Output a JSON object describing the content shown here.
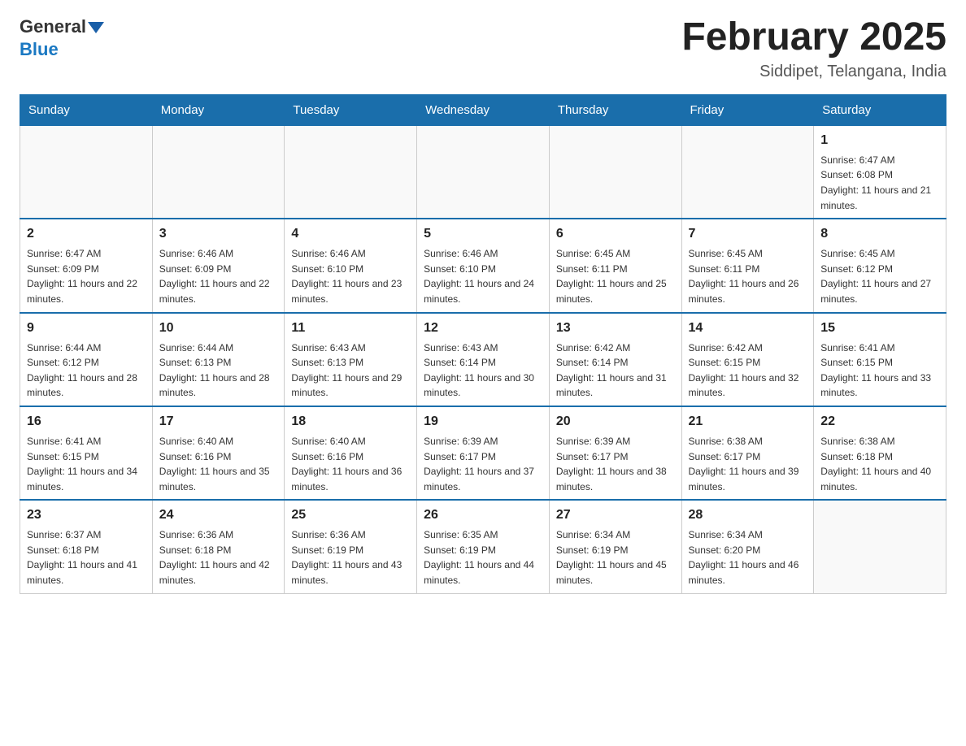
{
  "header": {
    "logo_general": "General",
    "logo_blue": "Blue",
    "title": "February 2025",
    "subtitle": "Siddipet, Telangana, India"
  },
  "weekdays": [
    "Sunday",
    "Monday",
    "Tuesday",
    "Wednesday",
    "Thursday",
    "Friday",
    "Saturday"
  ],
  "weeks": [
    [
      {
        "day": "",
        "info": ""
      },
      {
        "day": "",
        "info": ""
      },
      {
        "day": "",
        "info": ""
      },
      {
        "day": "",
        "info": ""
      },
      {
        "day": "",
        "info": ""
      },
      {
        "day": "",
        "info": ""
      },
      {
        "day": "1",
        "info": "Sunrise: 6:47 AM\nSunset: 6:08 PM\nDaylight: 11 hours and 21 minutes."
      }
    ],
    [
      {
        "day": "2",
        "info": "Sunrise: 6:47 AM\nSunset: 6:09 PM\nDaylight: 11 hours and 22 minutes."
      },
      {
        "day": "3",
        "info": "Sunrise: 6:46 AM\nSunset: 6:09 PM\nDaylight: 11 hours and 22 minutes."
      },
      {
        "day": "4",
        "info": "Sunrise: 6:46 AM\nSunset: 6:10 PM\nDaylight: 11 hours and 23 minutes."
      },
      {
        "day": "5",
        "info": "Sunrise: 6:46 AM\nSunset: 6:10 PM\nDaylight: 11 hours and 24 minutes."
      },
      {
        "day": "6",
        "info": "Sunrise: 6:45 AM\nSunset: 6:11 PM\nDaylight: 11 hours and 25 minutes."
      },
      {
        "day": "7",
        "info": "Sunrise: 6:45 AM\nSunset: 6:11 PM\nDaylight: 11 hours and 26 minutes."
      },
      {
        "day": "8",
        "info": "Sunrise: 6:45 AM\nSunset: 6:12 PM\nDaylight: 11 hours and 27 minutes."
      }
    ],
    [
      {
        "day": "9",
        "info": "Sunrise: 6:44 AM\nSunset: 6:12 PM\nDaylight: 11 hours and 28 minutes."
      },
      {
        "day": "10",
        "info": "Sunrise: 6:44 AM\nSunset: 6:13 PM\nDaylight: 11 hours and 28 minutes."
      },
      {
        "day": "11",
        "info": "Sunrise: 6:43 AM\nSunset: 6:13 PM\nDaylight: 11 hours and 29 minutes."
      },
      {
        "day": "12",
        "info": "Sunrise: 6:43 AM\nSunset: 6:14 PM\nDaylight: 11 hours and 30 minutes."
      },
      {
        "day": "13",
        "info": "Sunrise: 6:42 AM\nSunset: 6:14 PM\nDaylight: 11 hours and 31 minutes."
      },
      {
        "day": "14",
        "info": "Sunrise: 6:42 AM\nSunset: 6:15 PM\nDaylight: 11 hours and 32 minutes."
      },
      {
        "day": "15",
        "info": "Sunrise: 6:41 AM\nSunset: 6:15 PM\nDaylight: 11 hours and 33 minutes."
      }
    ],
    [
      {
        "day": "16",
        "info": "Sunrise: 6:41 AM\nSunset: 6:15 PM\nDaylight: 11 hours and 34 minutes."
      },
      {
        "day": "17",
        "info": "Sunrise: 6:40 AM\nSunset: 6:16 PM\nDaylight: 11 hours and 35 minutes."
      },
      {
        "day": "18",
        "info": "Sunrise: 6:40 AM\nSunset: 6:16 PM\nDaylight: 11 hours and 36 minutes."
      },
      {
        "day": "19",
        "info": "Sunrise: 6:39 AM\nSunset: 6:17 PM\nDaylight: 11 hours and 37 minutes."
      },
      {
        "day": "20",
        "info": "Sunrise: 6:39 AM\nSunset: 6:17 PM\nDaylight: 11 hours and 38 minutes."
      },
      {
        "day": "21",
        "info": "Sunrise: 6:38 AM\nSunset: 6:17 PM\nDaylight: 11 hours and 39 minutes."
      },
      {
        "day": "22",
        "info": "Sunrise: 6:38 AM\nSunset: 6:18 PM\nDaylight: 11 hours and 40 minutes."
      }
    ],
    [
      {
        "day": "23",
        "info": "Sunrise: 6:37 AM\nSunset: 6:18 PM\nDaylight: 11 hours and 41 minutes."
      },
      {
        "day": "24",
        "info": "Sunrise: 6:36 AM\nSunset: 6:18 PM\nDaylight: 11 hours and 42 minutes."
      },
      {
        "day": "25",
        "info": "Sunrise: 6:36 AM\nSunset: 6:19 PM\nDaylight: 11 hours and 43 minutes."
      },
      {
        "day": "26",
        "info": "Sunrise: 6:35 AM\nSunset: 6:19 PM\nDaylight: 11 hours and 44 minutes."
      },
      {
        "day": "27",
        "info": "Sunrise: 6:34 AM\nSunset: 6:19 PM\nDaylight: 11 hours and 45 minutes."
      },
      {
        "day": "28",
        "info": "Sunrise: 6:34 AM\nSunset: 6:20 PM\nDaylight: 11 hours and 46 minutes."
      },
      {
        "day": "",
        "info": ""
      }
    ]
  ]
}
